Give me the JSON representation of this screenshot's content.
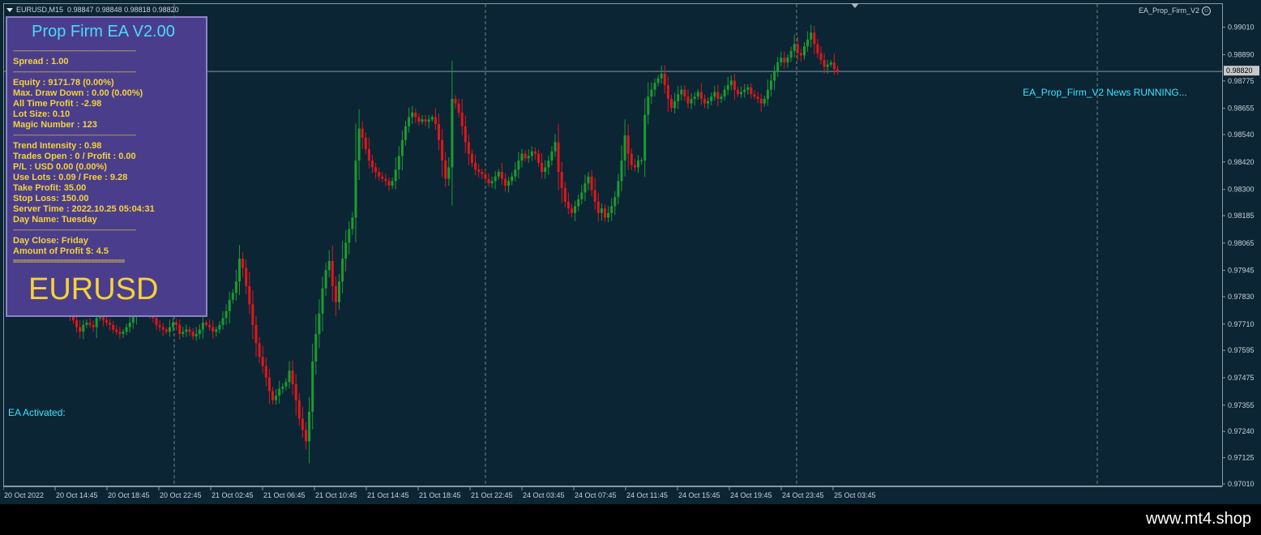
{
  "header": {
    "symbol_timeframe": "EURUSD,M15",
    "quotes": "0.98847 0.98848 0.98818 0.98820",
    "ea_name": "EA_Prop_Firm_V2",
    "smiley": "☺"
  },
  "panel": {
    "title": "Prop Firm EA V2.00",
    "separator": "----------------------------------------------------------------------",
    "equals_line": "=================================",
    "lines_a": [
      "Spread : 1.00"
    ],
    "lines_b": [
      "Equity : 9171.78 (0.00%)",
      "Max. Draw Down : 0.00 (0.00%)",
      "All Time Profit : -2.98",
      "Lot Size: 0.10",
      "Magic Number : 123"
    ],
    "lines_c": [
      "Trend Intensity : 0.98",
      "Trades Open : 0 / Profit : 0.00",
      "P/L : USD 0.00 (0.00%)",
      "Use Lots : 0.09 / Free : 9.28",
      "Take Profit: 35.00",
      "Stop Loss: 150.00",
      "Server Time : 2022.10.25 05:04:31",
      "Day Name: Tuesday"
    ],
    "lines_d": [
      "Day Close: Friday",
      "Amount of Profit $: 4.5"
    ],
    "symbol": "EURUSD"
  },
  "status": {
    "news": "EA_Prop_Firm_V2 News RUNNING...",
    "activated": "EA Activated:"
  },
  "watermark": "www.mt4.shop",
  "colors": {
    "background": "#0b2535",
    "bull": "#1f9a2e",
    "bear": "#e0161a",
    "panel_bg": "#4a3e8c",
    "panel_text": "#f5d23a",
    "title_text": "#4cd8ff",
    "status_text": "#3ee4ff",
    "current_price_line": "#8a98a4"
  },
  "chart_data": {
    "type": "candlestick",
    "symbol": "EURUSD",
    "timeframe": "M15",
    "current_price": "0.98820",
    "ylim": [
      0.9701,
      0.9903
    ],
    "y_ticks": [
      "0.99010",
      "0.98890",
      "0.98775",
      "0.98655",
      "0.98540",
      "0.98420",
      "0.98300",
      "0.98185",
      "0.98065",
      "0.97945",
      "0.97830",
      "0.97710",
      "0.97595",
      "0.97475",
      "0.97355",
      "0.97240",
      "0.97125",
      "0.97010"
    ],
    "x_ticks": [
      "20 Oct 2022",
      "20 Oct 14:45",
      "20 Oct 18:45",
      "20 Oct 22:45",
      "21 Oct 02:45",
      "21 Oct 06:45",
      "21 Oct 10:45",
      "21 Oct 14:45",
      "21 Oct 18:45",
      "21 Oct 22:45",
      "24 Oct 03:45",
      "24 Oct 07:45",
      "24 Oct 11:45",
      "24 Oct 15:45",
      "24 Oct 19:45",
      "24 Oct 23:45",
      "25 Oct 03:45"
    ],
    "period_separators_after": [
      "20 Oct 22:45",
      "21 Oct 22:45",
      "24 Oct 23:45"
    ],
    "closes": [
      0.9784,
      0.9786,
      0.9784,
      0.9783,
      0.9782,
      0.978,
      0.978,
      0.9779,
      0.9781,
      0.9782,
      0.9783,
      0.9784,
      0.9785,
      0.9783,
      0.9782,
      0.9781,
      0.9779,
      0.978,
      0.9778,
      0.9776,
      0.9773,
      0.977,
      0.9768,
      0.9771,
      0.9772,
      0.9771,
      0.977,
      0.9774,
      0.9776,
      0.9773,
      0.9772,
      0.9771,
      0.9769,
      0.9768,
      0.9767,
      0.9768,
      0.977,
      0.9772,
      0.9775,
      0.9778,
      0.9781,
      0.9783,
      0.978,
      0.9777,
      0.9774,
      0.9771,
      0.977,
      0.9769,
      0.9768,
      0.977,
      0.9772,
      0.9771,
      0.9767,
      0.9768,
      0.9769,
      0.9768,
      0.9766,
      0.9767,
      0.9769,
      0.9772,
      0.9771,
      0.977,
      0.9768,
      0.9769,
      0.9771,
      0.9774,
      0.9777,
      0.9782,
      0.9785,
      0.979,
      0.98,
      0.9796,
      0.9788,
      0.978,
      0.9771,
      0.9763,
      0.9757,
      0.9753,
      0.9748,
      0.9742,
      0.9738,
      0.974,
      0.9743,
      0.9744,
      0.9746,
      0.9751,
      0.9745,
      0.9738,
      0.973,
      0.9725,
      0.972,
      0.9733,
      0.9755,
      0.9767,
      0.9776,
      0.9787,
      0.9795,
      0.9799,
      0.9788,
      0.9781,
      0.979,
      0.98,
      0.9807,
      0.9813,
      0.9818,
      0.9843,
      0.9857,
      0.9853,
      0.9848,
      0.9843,
      0.984,
      0.9838,
      0.9836,
      0.9835,
      0.9834,
      0.9832,
      0.9834,
      0.9839,
      0.9845,
      0.9852,
      0.9858,
      0.9862,
      0.9864,
      0.9862,
      0.986,
      0.9861,
      0.986,
      0.9861,
      0.9862,
      0.9859,
      0.9852,
      0.9843,
      0.9835,
      0.984,
      0.987,
      0.9868,
      0.9864,
      0.9858,
      0.9851,
      0.9846,
      0.9842,
      0.9839,
      0.9838,
      0.9837,
      0.9835,
      0.9833,
      0.9834,
      0.9836,
      0.9838,
      0.9835,
      0.9832,
      0.9834,
      0.9836,
      0.9839,
      0.9843,
      0.9846,
      0.9844,
      0.9845,
      0.9847,
      0.9846,
      0.9842,
      0.9838,
      0.984,
      0.9843,
      0.9847,
      0.9851,
      0.9838,
      0.9831,
      0.9825,
      0.9822,
      0.982,
      0.9823,
      0.9826,
      0.9829,
      0.9833,
      0.9836,
      0.983,
      0.9825,
      0.982,
      0.9822,
      0.9818,
      0.982,
      0.9823,
      0.9827,
      0.9834,
      0.9843,
      0.9854,
      0.9846,
      0.9841,
      0.984,
      0.9843,
      0.9843,
      0.9863,
      0.9871,
      0.9874,
      0.9877,
      0.9879,
      0.9881,
      0.9876,
      0.987,
      0.9866,
      0.9869,
      0.9872,
      0.9874,
      0.9871,
      0.9868,
      0.987,
      0.9871,
      0.9873,
      0.987,
      0.9868,
      0.9869,
      0.9871,
      0.9873,
      0.987,
      0.9871,
      0.9874,
      0.9876,
      0.9878,
      0.9874,
      0.9872,
      0.9873,
      0.9874,
      0.9875,
      0.9872,
      0.9871,
      0.987,
      0.9868,
      0.987,
      0.9874,
      0.9878,
      0.9882,
      0.9886,
      0.9888,
      0.9886,
      0.9888,
      0.9891,
      0.9894,
      0.989,
      0.9889,
      0.9893,
      0.9896,
      0.9899,
      0.9894,
      0.989,
      0.9887,
      0.9884,
      0.9885,
      0.9886,
      0.9883,
      0.9882
    ]
  }
}
